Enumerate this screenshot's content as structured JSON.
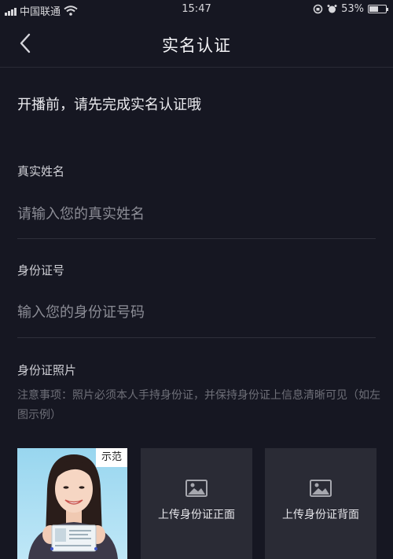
{
  "status_bar": {
    "carrier": "中国联通",
    "time": "15:47",
    "battery": "53%",
    "battery_level": 0.53
  },
  "nav": {
    "title": "实名认证"
  },
  "notice": "开播前，请先完成实名认证哦",
  "form": {
    "name": {
      "label": "真实姓名",
      "placeholder": "请输入您的真实姓名",
      "value": ""
    },
    "id_number": {
      "label": "身份证号",
      "placeholder": "输入您的身份证号码",
      "value": ""
    },
    "photo": {
      "label": "身份证照片",
      "note": "注意事项：照片必须本人手持身份证，并保持身份证上信息清晰可见（如左图示例）",
      "sample_tag": "示范",
      "upload_front": "上传身份证正面",
      "upload_back": "上传身份证背面"
    }
  },
  "colors": {
    "background": "#161722",
    "upload_box": "#2a2b35",
    "text_muted": "#6e6f78"
  }
}
